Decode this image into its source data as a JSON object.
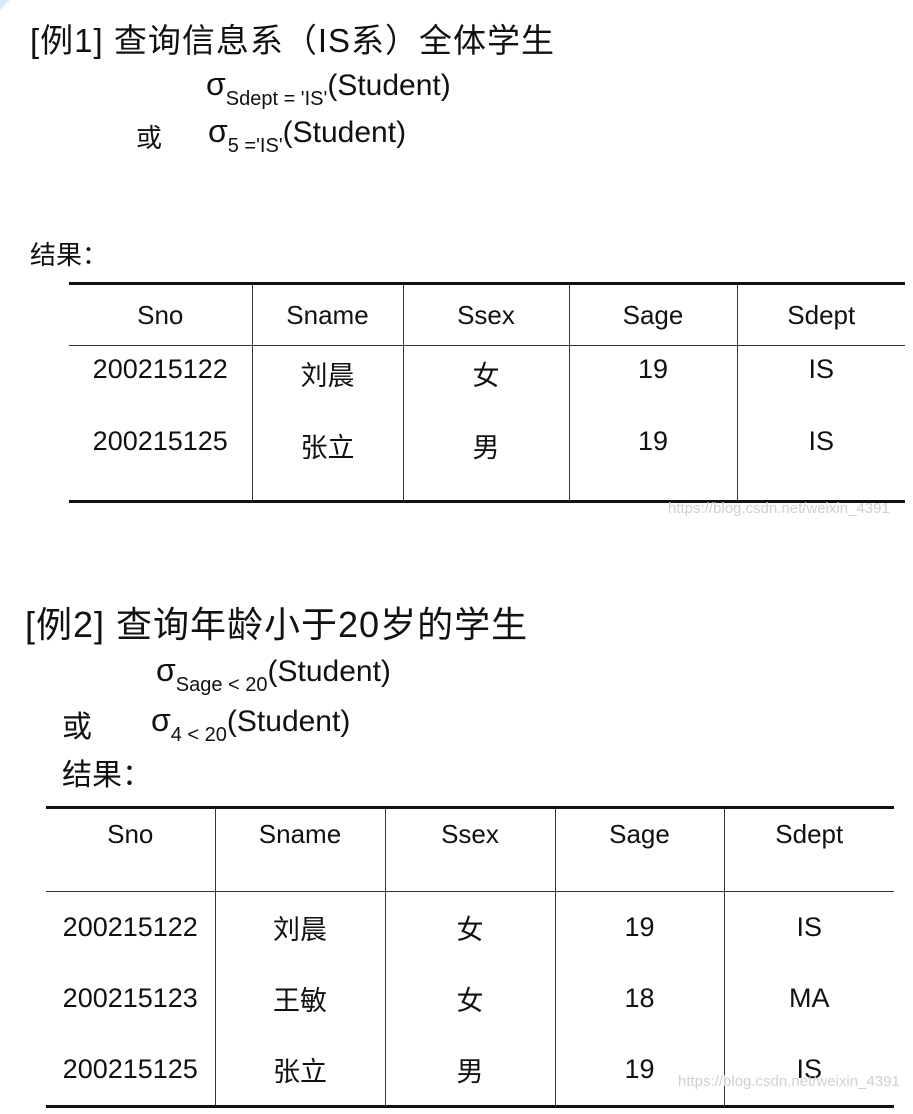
{
  "example1": {
    "title": "[例1]  查询信息系（IS系）全体学生",
    "formula1": {
      "sigma": "σ",
      "sub": "Sdept = 'IS'",
      "rest": "(Student)"
    },
    "or_label": "或",
    "formula2": {
      "sigma": "σ",
      "sub": "5 ='IS'",
      "rest": "(Student)"
    },
    "result_label": "结果：",
    "table": {
      "headers": [
        "Sno",
        "Sname",
        "Ssex",
        "Sage",
        "Sdept"
      ],
      "rows": [
        [
          "200215122",
          "刘晨",
          "女",
          "19",
          "IS"
        ],
        [
          "200215125",
          "张立",
          "男",
          "19",
          "IS"
        ]
      ]
    },
    "watermark": "https://blog.csdn.net/weixin_4391"
  },
  "example2": {
    "title": "[例2]  查询年龄小于20岁的学生",
    "formula1": {
      "sigma": "σ",
      "sub": "Sage < 20",
      "rest": "(Student)"
    },
    "or_label": "或",
    "formula2": {
      "sigma": "σ",
      "sub": "4 < 20",
      "rest": "(Student)"
    },
    "result_label": "结果：",
    "table": {
      "headers": [
        "Sno",
        "Sname",
        "Ssex",
        "Sage",
        "Sdept"
      ],
      "rows": [
        [
          "200215122",
          "刘晨",
          "女",
          "19",
          "IS"
        ],
        [
          "200215123",
          "王敏",
          "女",
          "18",
          "MA"
        ],
        [
          "200215125",
          "张立",
          "男",
          "19",
          "IS"
        ]
      ]
    },
    "watermark": "https://blog.csdn.net/weixin_4391"
  }
}
